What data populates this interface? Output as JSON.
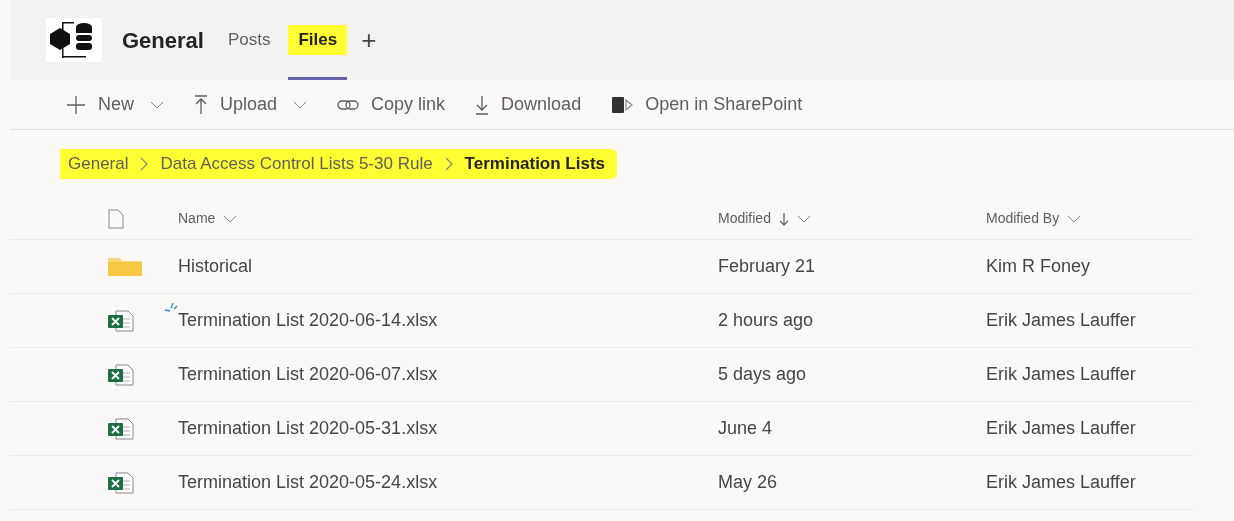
{
  "header": {
    "team": "General",
    "tabs": [
      {
        "label": "Posts",
        "selected": false,
        "highlighted": false
      },
      {
        "label": "Files",
        "selected": true,
        "highlighted": true
      }
    ],
    "add_tab": "+"
  },
  "toolbar": [
    {
      "label": "New",
      "kind": "new",
      "dropdown": true
    },
    {
      "label": "Upload",
      "kind": "upload",
      "dropdown": true
    },
    {
      "label": "Copy link",
      "kind": "link",
      "dropdown": false
    },
    {
      "label": "Download",
      "kind": "download",
      "dropdown": false
    },
    {
      "label": "Open in SharePoint",
      "kind": "sharepoint",
      "dropdown": false
    }
  ],
  "breadcrumb": [
    {
      "label": "General",
      "current": false,
      "highlighted": true
    },
    {
      "label": "Data Access Control Lists 5-30 Rule",
      "current": false,
      "highlighted": true
    },
    {
      "label": "Termination Lists",
      "current": true,
      "highlighted": true
    }
  ],
  "table": {
    "columns": [
      {
        "label": "Name",
        "sorted": false
      },
      {
        "label": "Modified",
        "sorted": true
      },
      {
        "label": "Modified By",
        "sorted": false
      }
    ],
    "rows": [
      {
        "kind": "folder",
        "recent": false,
        "name": "Historical",
        "modified": "February 21",
        "modified_by": "Kim R Foney"
      },
      {
        "kind": "excel",
        "recent": true,
        "name": "Termination List 2020-06-14.xlsx",
        "modified": "2 hours ago",
        "modified_by": "Erik James Lauffer"
      },
      {
        "kind": "excel",
        "recent": false,
        "name": "Termination List 2020-06-07.xlsx",
        "modified": "5 days ago",
        "modified_by": "Erik James Lauffer"
      },
      {
        "kind": "excel",
        "recent": false,
        "name": "Termination List 2020-05-31.xlsx",
        "modified": "June 4",
        "modified_by": "Erik James Lauffer"
      },
      {
        "kind": "excel",
        "recent": false,
        "name": "Termination List 2020-05-24.xlsx",
        "modified": "May 26",
        "modified_by": "Erik James Lauffer"
      }
    ]
  }
}
